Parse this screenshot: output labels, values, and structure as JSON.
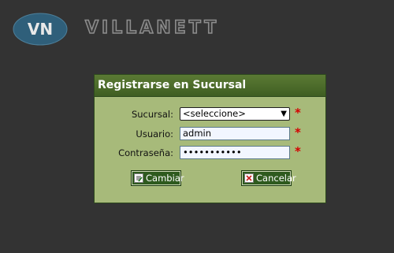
{
  "logo": {
    "initials": "VN",
    "brand": "VILLANETT"
  },
  "dialog": {
    "title": "Registrarse en Sucursal",
    "fields": {
      "sucursal": {
        "label": "Sucursal:",
        "value": "<seleccione>",
        "required_mark": "*"
      },
      "usuario": {
        "label": "Usuario:",
        "value": "admin",
        "required_mark": "*"
      },
      "contrasena": {
        "label": "Contraseña:",
        "value": "•••••••••••",
        "required_mark": "*"
      }
    },
    "buttons": {
      "cambiar": "Cambiar",
      "cancelar": "Cancelar"
    }
  },
  "colors": {
    "background": "#333333",
    "dialog_body": "#a7ba7a",
    "title_bar": "#4a6a2a",
    "button": "#2e5a1e",
    "required": "#d40000",
    "logo_badge": "#2f5f7a"
  },
  "icons": {
    "cambiar_button": "edit-document-icon",
    "cancelar_button": "cancel-document-icon",
    "select_arrow": "chevron-down-icon"
  }
}
